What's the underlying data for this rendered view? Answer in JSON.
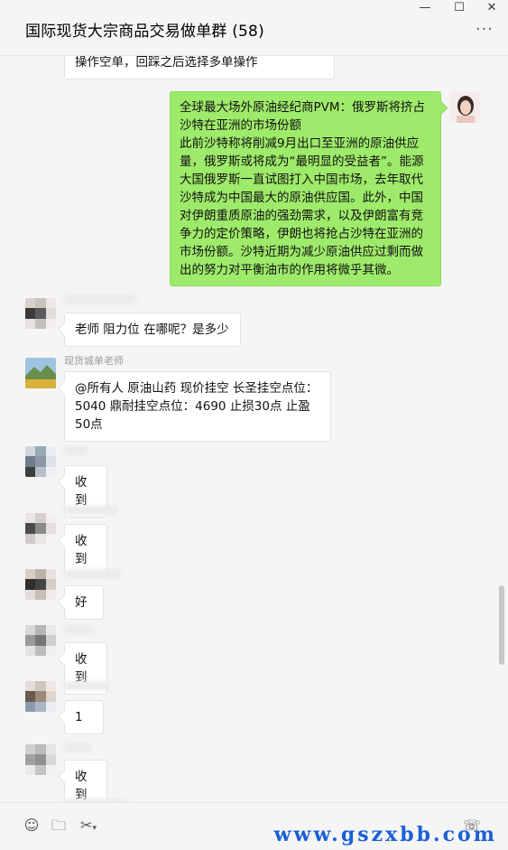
{
  "window": {
    "title": "国际现货大宗商品交易做单群 (58)",
    "controls": {
      "min": "—",
      "max": "☐",
      "close": "✕"
    },
    "more": "···"
  },
  "messages": {
    "m0": "操作空单，回踩之后选择多单操作",
    "m1": "全球最大场外原油经纪商PVM：俄罗斯将挤占沙特在亚洲的市场份额\n此前沙特称将削减9月出口至亚洲的原油供应量，俄罗斯或将成为“最明显的受益者”。能源大国俄罗斯一直试图打入中国市场，去年取代沙特成为中国最大的原油供应国。此外，中国对伊朗重质原油的强劲需求，以及伊朗富有竞争力的定价策略，伊朗也将抢占沙特在亚洲的市场份额。沙特近期为减少原油供应过剩而做出的努力对平衡油市的作用将微乎其微。",
    "m2": "老师 阻力位 在哪呢？是多少",
    "m3_sender": "现货城单老师",
    "m3": "@所有人  原油山药 现价挂空  长圣挂空点位：5040   鼎耐挂空点位：4690   止损30点 止盈 50点",
    "m4": "收到",
    "m5": "收到",
    "m6": "好",
    "m7": "收到",
    "m8": "1",
    "m9": "收到"
  },
  "toolbar": {
    "emoji_icon": "☺",
    "folder_icon": "🗀",
    "scissors_icon": "✂",
    "video_icon": "☏"
  },
  "watermark": "www.gszxbb.com"
}
